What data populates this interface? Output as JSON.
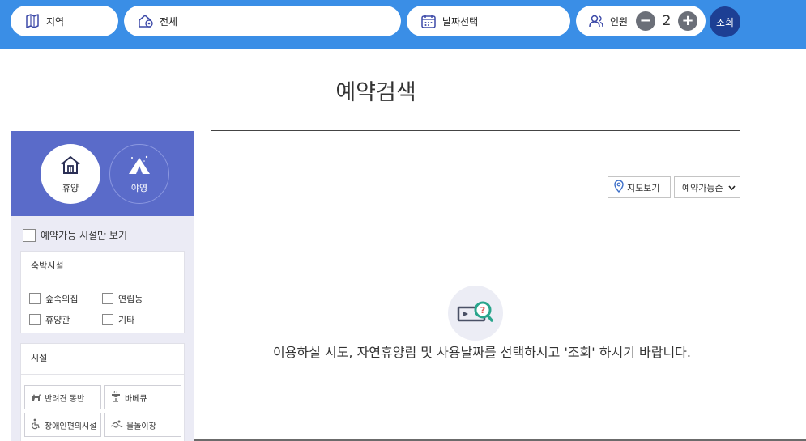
{
  "topbar": {
    "region_label": "지역",
    "all_label": "전체",
    "date_label": "날짜선택",
    "people_label": "인원",
    "people_count": "2",
    "minus_glyph": "−",
    "plus_glyph": "+",
    "search_label": "조회",
    "accent": "#3a8ee6",
    "search_color": "#1d3f94"
  },
  "page": {
    "title": "예약검색"
  },
  "sidebar": {
    "categories": [
      {
        "label": "휴양",
        "icon": "house-icon",
        "active": true
      },
      {
        "label": "야영",
        "icon": "tent-icon",
        "active": false
      }
    ],
    "available_only_label": "예약가능 시설만 보기",
    "lodging": {
      "title": "숙박시설",
      "options": [
        "숲속의집",
        "연립동",
        "휴양관",
        "기타"
      ]
    },
    "facility": {
      "title": "시설",
      "options": [
        {
          "label": "반려견 동반",
          "icon": "dog-icon"
        },
        {
          "label": "바베큐",
          "icon": "grill-icon"
        },
        {
          "label": "장애인편의시설",
          "icon": "wheelchair-icon"
        },
        {
          "label": "물놀이장",
          "icon": "swim-icon"
        }
      ]
    },
    "header_color": "#5a6bc9"
  },
  "main": {
    "map_view_label": "지도보기",
    "sort_label": "예약가능순",
    "empty_message": "이용하실 시도, 자연휴양림 및 사용날짜를 선택하시고 '조회' 하시기 바랍니다."
  }
}
